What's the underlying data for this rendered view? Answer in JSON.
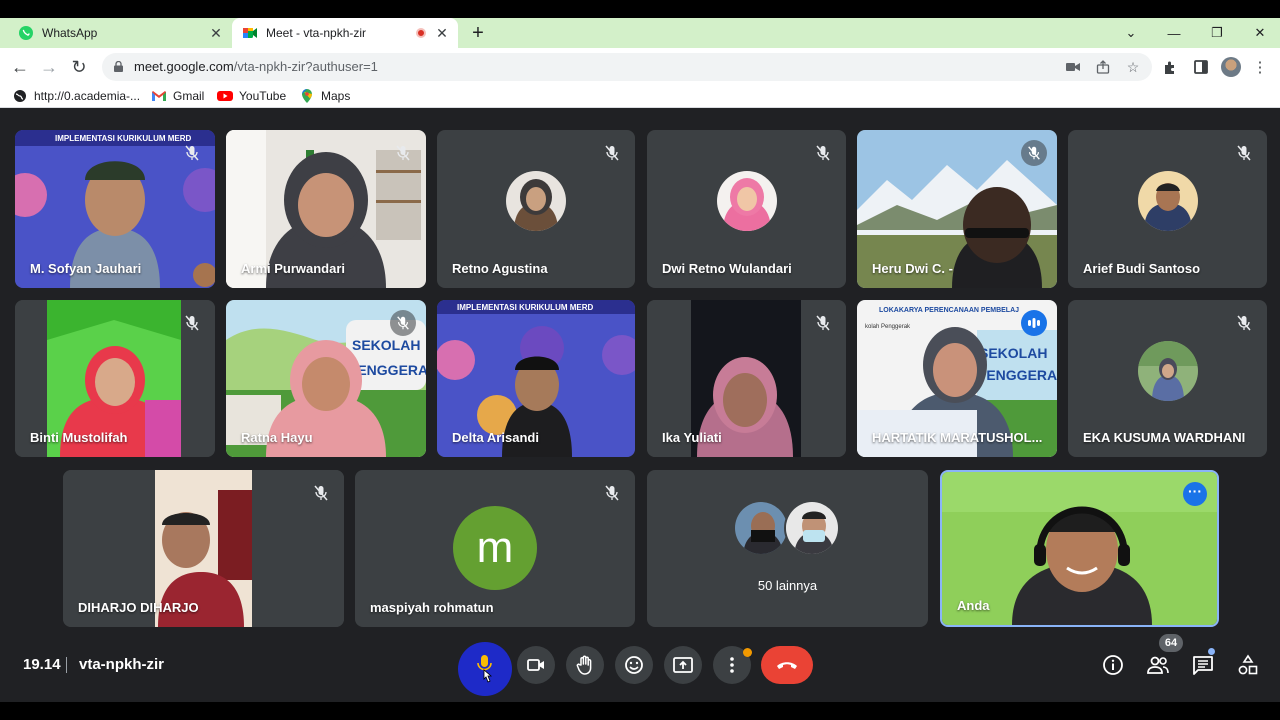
{
  "browser": {
    "tabs": [
      {
        "title": "WhatsApp",
        "icon": "whatsapp-icon",
        "active": false
      },
      {
        "title": "Meet - vta-npkh-zir",
        "icon": "google-meet-icon",
        "active": true,
        "recording": true
      }
    ],
    "url_host": "meet.google.com",
    "url_path": "/vta-npkh-zir?authuser=1",
    "bookmarks": [
      {
        "label": "http://0.academia-...",
        "icon": "globe-icon"
      },
      {
        "label": "Gmail",
        "icon": "gmail-icon"
      },
      {
        "label": "YouTube",
        "icon": "youtube-icon"
      },
      {
        "label": "Maps",
        "icon": "maps-icon"
      }
    ]
  },
  "meeting": {
    "time": "19.14",
    "code": "vta-npkh-zir",
    "participant_count": "64",
    "others_label": "50 lainnya",
    "self_label": "Anda",
    "tiles": [
      {
        "name": "M. Sofyan Jauhari"
      },
      {
        "name": "Armi Purwandari"
      },
      {
        "name": "Retno Agustina"
      },
      {
        "name": "Dwi Retno Wulandari"
      },
      {
        "name": "Heru Dwi C. -"
      },
      {
        "name": "Arief Budi Santoso"
      },
      {
        "name": "Binti Mustolifah"
      },
      {
        "name": "Ratna Hayu"
      },
      {
        "name": "Delta Arisandi"
      },
      {
        "name": "Ika Yuliati"
      },
      {
        "name": "HARTATIK MARATUSHOL..."
      },
      {
        "name": "EKA KUSUMA WARDHANI"
      },
      {
        "name": "DIHARJO DIHARJO"
      },
      {
        "name": "maspiyah rohmatun",
        "initial": "m"
      }
    ],
    "slides": {
      "banner_title": "IMPLEMENTASI KURIKULUM MERD",
      "sekolah_line1": "SEKOLAH",
      "sekolah_line2": "PENGGERA",
      "loka_title": "LOKAKARYA PERENCANAAN PEMBELAJ",
      "loka_sub": "kolah Penggerak",
      "avatar_letter_color": "#64a031"
    }
  },
  "colors": {
    "tabstrip": "#d3f0c9",
    "stage": "#202124",
    "tile": "#3c4043",
    "mic_active": "#1e2ac8",
    "end_call": "#ea4335",
    "self_border": "#8ab4f8"
  }
}
